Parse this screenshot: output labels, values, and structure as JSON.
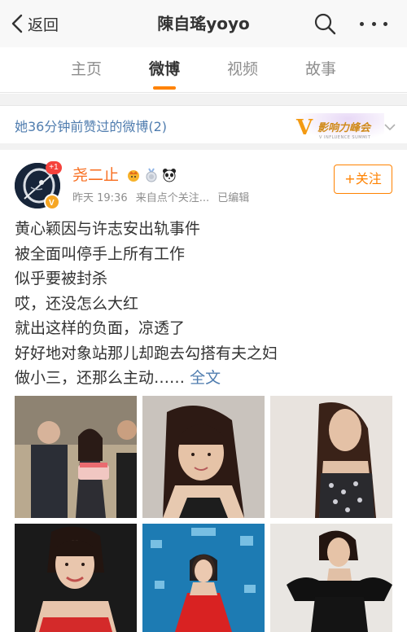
{
  "nav": {
    "back_label": "返回",
    "title": "陳自瑤yoyo"
  },
  "tabs": [
    "主页",
    "微博",
    "视频",
    "故事"
  ],
  "active_tab": "微博",
  "liked_bar": {
    "text": "她36分钟前赞过的微博(2)"
  },
  "brand": {
    "v": "V",
    "text": "影响力峰会",
    "sub": "V INFLUENCE SUMMIT"
  },
  "post": {
    "avatar_badge": "+1",
    "author": "尧二止",
    "time": "昨天 19:36",
    "source": "来自点个关注...",
    "edited": "已编辑",
    "follow_label": "+关注",
    "lines": [
      "黄心颖因与许志安出轨事件",
      "被全面叫停手上所有工作",
      "似乎要被封杀",
      "哎，还没怎么大红",
      "就出这样的负面，凉透了",
      "好好地对象站那儿却跑去勾搭有夫之妇"
    ],
    "last_line": "做小三，还那么主动……",
    "full_text": "全文"
  },
  "colors": {
    "accent": "#ff8200",
    "link": "#507daf",
    "author": "#f86d1e"
  }
}
